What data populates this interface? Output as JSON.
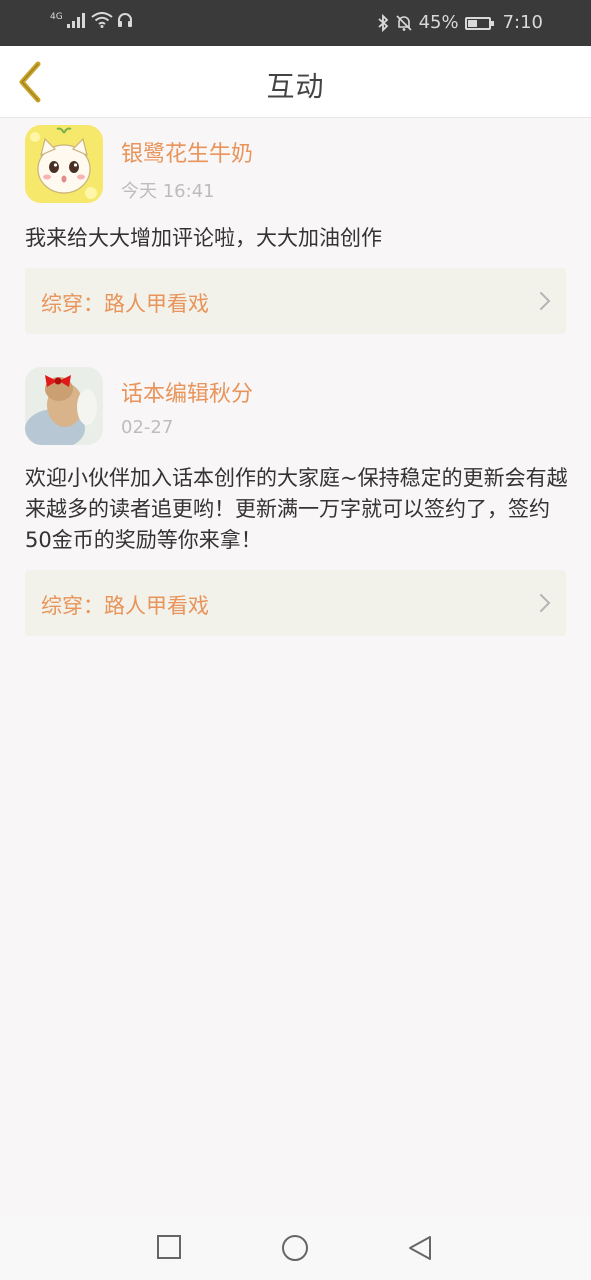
{
  "status_bar": {
    "network": "4G",
    "battery": "45%",
    "battery_level": 0.45,
    "time": "7:10"
  },
  "header": {
    "title": "互动",
    "back_icon": "chevron-left-icon"
  },
  "interactions": [
    {
      "username": "银鹭花生牛奶",
      "time": "今天 16:41",
      "content": "我来给大大增加评论啦，大大加油创作",
      "work": "综穿：路人甲看戏"
    },
    {
      "username": "话本编辑秋分",
      "time": "02-27",
      "content": "欢迎小伙伴加入话本创作的大家庭~保持稳定的更新会有越来越多的读者追更哟！更新满一万字就可以签约了，签约50金币的奖励等你来拿！",
      "work": "综穿：路人甲看戏"
    }
  ],
  "colors": {
    "accent": "#e8945a",
    "back_icon": "#c9a227",
    "status_bar_bg": "#3a3a3a",
    "work_link_bg": "#f2f1ea"
  },
  "system_nav": {
    "recents_icon": "square-icon",
    "home_icon": "circle-icon",
    "back_icon": "triangle-back-icon"
  }
}
